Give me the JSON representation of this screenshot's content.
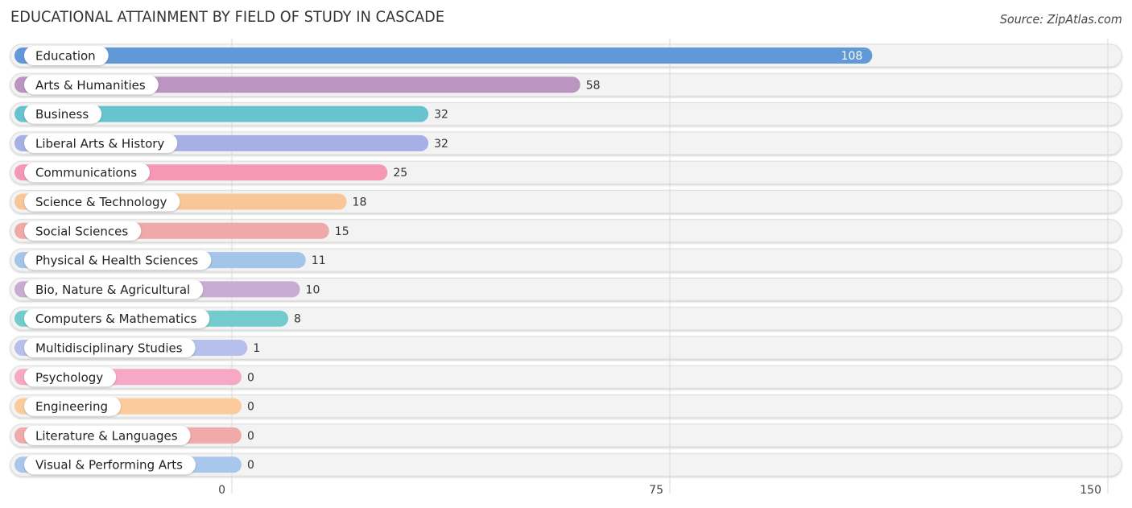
{
  "chart_data": {
    "type": "bar",
    "orientation": "horizontal",
    "title": "EDUCATIONAL ATTAINMENT BY FIELD OF STUDY IN CASCADE",
    "source": "Source: ZipAtlas.com",
    "xlabel": "",
    "ylabel": "",
    "xlim": [
      0,
      150
    ],
    "xticks": [
      0,
      75,
      150
    ],
    "xtick_labels": [
      "0",
      "75",
      "150"
    ],
    "grid": true,
    "categories": [
      "Education",
      "Arts & Humanities",
      "Business",
      "Liberal Arts & History",
      "Communications",
      "Science & Technology",
      "Social Sciences",
      "Physical & Health Sciences",
      "Bio, Nature & Agricultural",
      "Computers & Mathematics",
      "Multidisciplinary Studies",
      "Psychology",
      "Engineering",
      "Literature & Languages",
      "Visual & Performing Arts"
    ],
    "values": [
      108,
      58,
      32,
      32,
      25,
      18,
      15,
      11,
      10,
      8,
      1,
      0,
      0,
      0,
      0
    ],
    "value_labels": [
      "108",
      "58",
      "32",
      "32",
      "25",
      "18",
      "15",
      "11",
      "10",
      "8",
      "1",
      "0",
      "0",
      "0",
      "0"
    ],
    "colors": [
      "#6199d8",
      "#bb94c2",
      "#67c3cd",
      "#a7b0e6",
      "#f498b5",
      "#f9c697",
      "#eea9a8",
      "#a4c4ea",
      "#c9acd1",
      "#74cbce",
      "#b7bfec",
      "#f7a8c4",
      "#fbcb9e",
      "#f0aaa9",
      "#a9c7ec"
    ]
  }
}
